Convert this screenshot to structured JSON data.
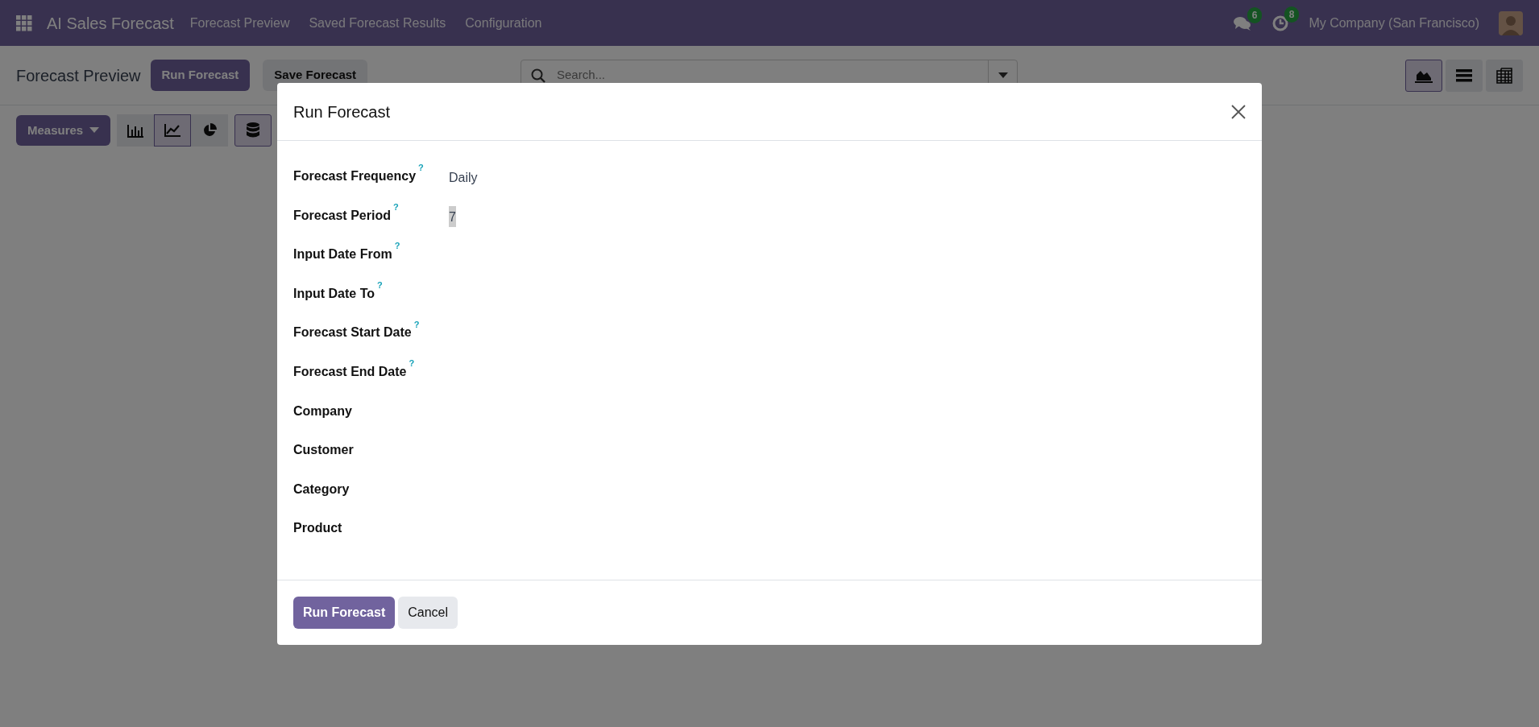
{
  "navbar": {
    "app_title": "AI Sales Forecast",
    "menu": [
      {
        "label": "Forecast Preview"
      },
      {
        "label": "Saved Forecast Results"
      },
      {
        "label": "Configuration"
      }
    ],
    "messages_count": "6",
    "activities_count": "8",
    "company": "My Company (San Francisco)"
  },
  "control_panel": {
    "breadcrumb": "Forecast Preview",
    "buttons": [
      {
        "label": "Run Forecast",
        "kind": "primary"
      },
      {
        "label": "Save Forecast",
        "kind": "secondary"
      }
    ],
    "search": {
      "placeholder": "Search..."
    },
    "views": [
      {
        "selected": true
      },
      {
        "selected": false
      },
      {
        "selected": false
      }
    ]
  },
  "graph_toolbar": {
    "measures": "Measures",
    "chart_types": [
      {
        "selected": false
      },
      {
        "selected": true
      },
      {
        "selected": false
      }
    ],
    "options": [
      {
        "selected": true
      }
    ]
  },
  "dialog": {
    "title": "Run Forecast",
    "fields": [
      {
        "label": "Forecast Frequency",
        "help": "?",
        "value": "Daily",
        "highlighted": false
      },
      {
        "label": "Forecast Period",
        "help": "?",
        "value": "7",
        "highlighted": true
      },
      {
        "label": "Input Date From",
        "help": "?"
      },
      {
        "label": "Input Date To",
        "help": "?"
      },
      {
        "label": "Forecast Start Date",
        "help": "?"
      },
      {
        "label": "Forecast End Date",
        "help": "?"
      },
      {
        "label": "Company"
      },
      {
        "label": "Customer"
      },
      {
        "label": "Category"
      },
      {
        "label": "Product"
      }
    ],
    "buttons": [
      {
        "label": "Run Forecast",
        "kind": "primary"
      },
      {
        "label": "Cancel",
        "kind": "secondary"
      }
    ]
  }
}
